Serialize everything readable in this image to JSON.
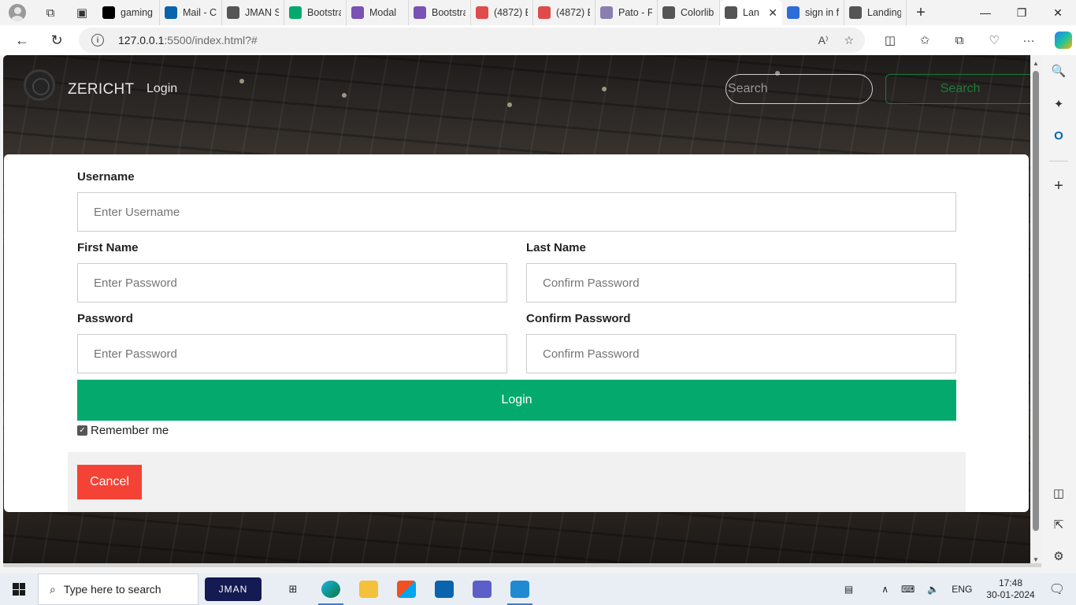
{
  "browser": {
    "tabs": [
      {
        "title": "gaming",
        "icon": "github-icon",
        "color": "#000000"
      },
      {
        "title": "Mail - C",
        "icon": "outlook-icon",
        "color": "#0a64ad"
      },
      {
        "title": "JMAN S",
        "icon": "page-icon",
        "color": "#555555"
      },
      {
        "title": "Bootstra",
        "icon": "w3-icon",
        "color": "#04aa6d"
      },
      {
        "title": "Modal",
        "icon": "bootstrap-icon",
        "color": "#7952b3"
      },
      {
        "title": "Bootstra",
        "icon": "bootstrap-icon",
        "color": "#7952b3"
      },
      {
        "title": "(4872) E",
        "icon": "youtube-icon",
        "color": "#e04b4b"
      },
      {
        "title": "(4872) E",
        "icon": "youtube-icon",
        "color": "#e04b4b"
      },
      {
        "title": "Pato - F",
        "icon": "colorlib-icon",
        "color": "#8a7fb0"
      },
      {
        "title": "Colorlib",
        "icon": "page-icon",
        "color": "#555555"
      },
      {
        "title": "Lan",
        "icon": "page-icon",
        "color": "#555555",
        "active": true
      },
      {
        "title": "sign in f",
        "icon": "search-icon",
        "color": "#2b6cd6"
      },
      {
        "title": "Landing",
        "icon": "page-icon",
        "color": "#555555"
      }
    ],
    "url_host": "127.0.0.1",
    "url_rest": ":5500/index.html?#"
  },
  "navbar": {
    "brand": "ZERICHT",
    "link": "Login",
    "search_placeholder": "Search",
    "search_button": "Search"
  },
  "form": {
    "username_label": "Username",
    "username_placeholder": "Enter Username",
    "first_name_label": "First Name",
    "first_name_placeholder": "Enter Password",
    "last_name_label": "Last Name",
    "last_name_placeholder": "Confirm Password",
    "password_label": "Password",
    "password_placeholder": "Enter Password",
    "confirm_label": "Confirm Password",
    "confirm_placeholder": "Confirm Password",
    "login_button": "Login",
    "remember_label": "Remember me",
    "remember_checked": true,
    "cancel_button": "Cancel"
  },
  "taskbar": {
    "search_text": "Type here to search",
    "jman_label": "JMAN",
    "language": "ENG",
    "time": "17:48",
    "date": "30-01-2024"
  },
  "colors": {
    "login_green": "#04aa6d",
    "cancel_red": "#f44336"
  }
}
